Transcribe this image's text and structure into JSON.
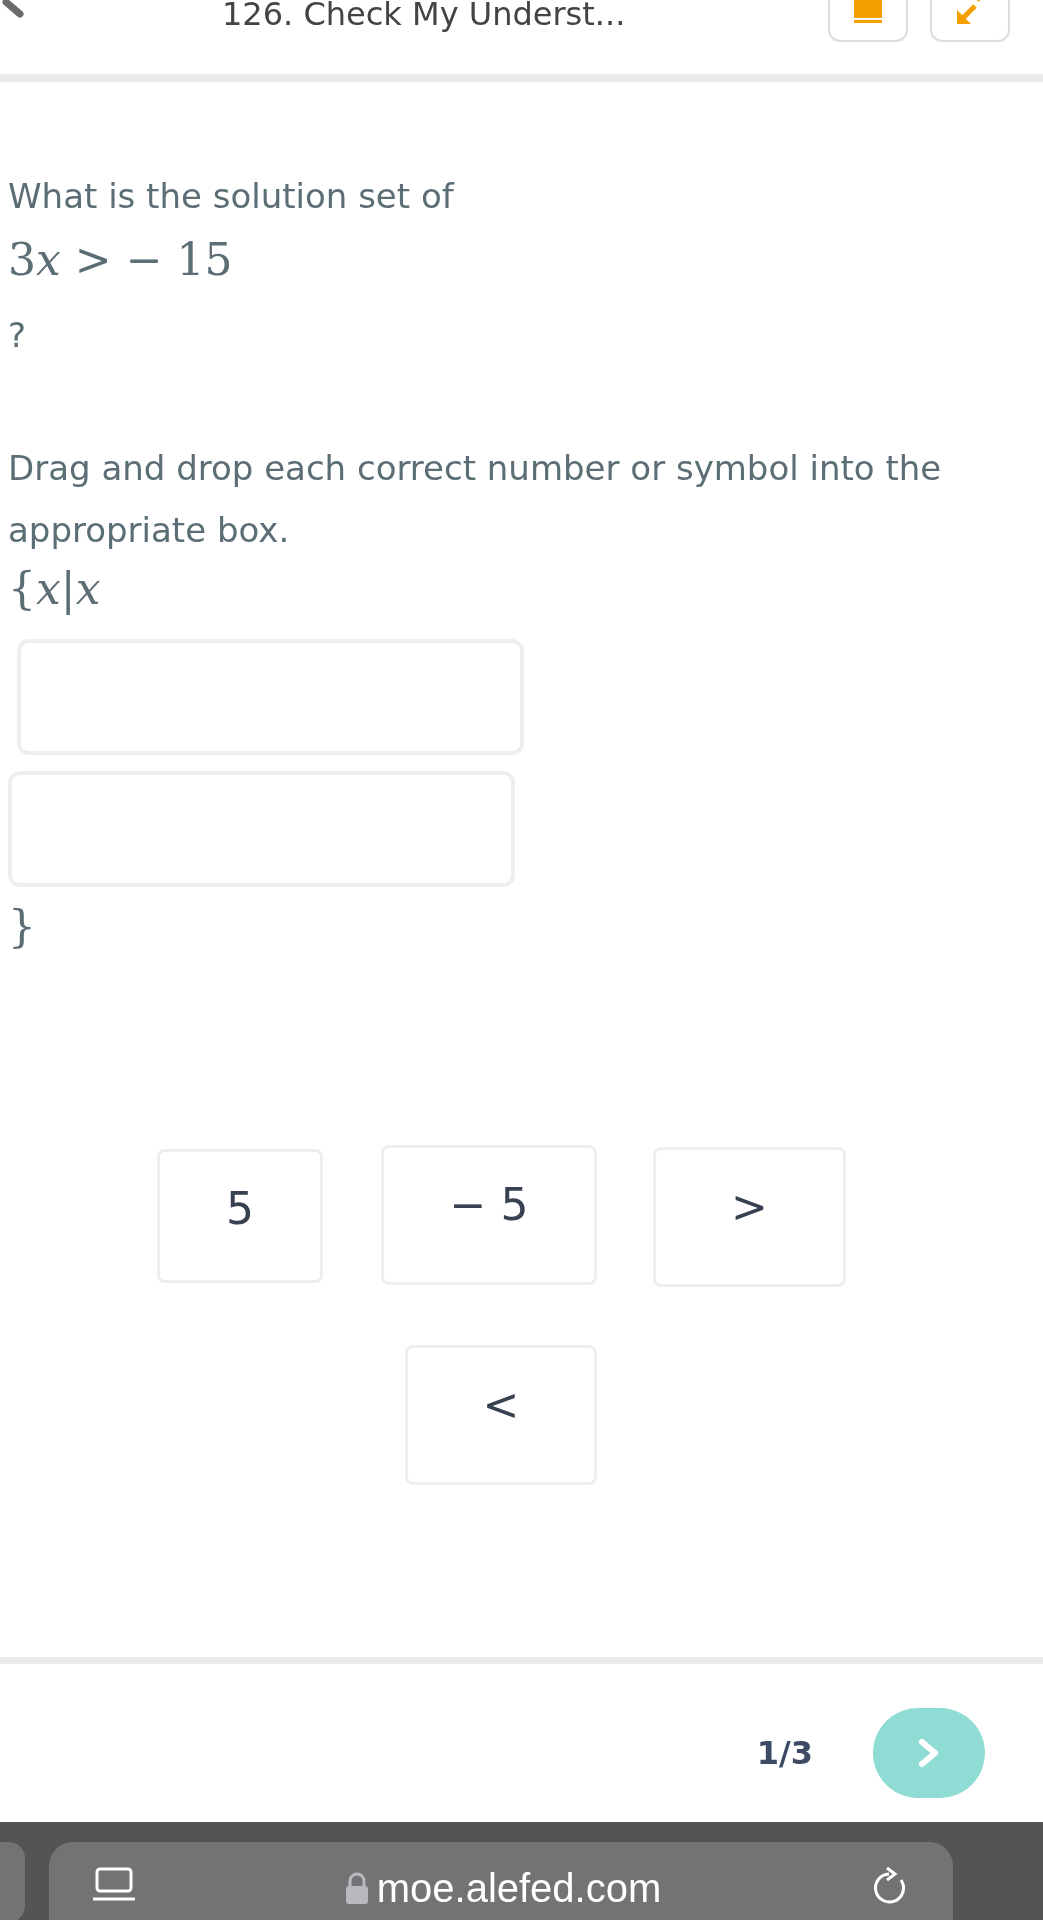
{
  "header": {
    "title": "126. Check My Underst..."
  },
  "question": {
    "prompt": "What is the solution set of",
    "expression": [
      "3",
      "x",
      "> − 15"
    ],
    "mark": "?",
    "instruction": "Drag and drop each correct number or symbol into the appropriate box.",
    "set_open": [
      "{",
      "x",
      "|",
      "x"
    ],
    "drop_boxes": [
      {
        "kind": "empty"
      },
      {
        "kind": "empty"
      }
    ],
    "set_close": "}"
  },
  "tiles": [
    {
      "label": "5"
    },
    {
      "label": "− 5"
    },
    {
      "label": ">"
    },
    {
      "label": "<"
    }
  ],
  "footer": {
    "progress": "1/3"
  },
  "browser": {
    "url": "moe.alefed.com"
  }
}
